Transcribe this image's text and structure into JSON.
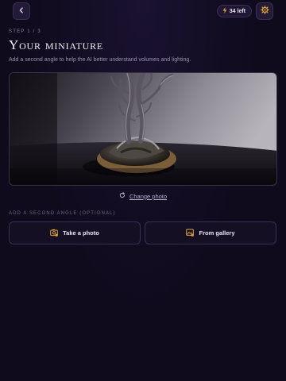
{
  "header": {
    "back_icon": "chevron-left-icon",
    "credits": {
      "icon": "bolt-icon",
      "label": "34 left"
    },
    "settings_icon": "gear-icon"
  },
  "step": {
    "label": "STEP 1 / 3"
  },
  "title": "Your miniature",
  "subtitle": "Add a second angle to help the AI better understand volumes and lighting.",
  "photo": {
    "description_icon": "miniature-photo"
  },
  "change_photo": {
    "icon": "refresh-icon",
    "label": "Change photo"
  },
  "second_angle": {
    "section_label": "ADD A SECOND ANGLE (OPTIONAL)",
    "take_photo": {
      "icon": "camera-icon",
      "label": "Take a photo"
    },
    "from_gallery": {
      "icon": "gallery-icon",
      "label": "From gallery"
    }
  },
  "colors": {
    "accent": "#e0a43a",
    "background": "#0f0a1c"
  }
}
